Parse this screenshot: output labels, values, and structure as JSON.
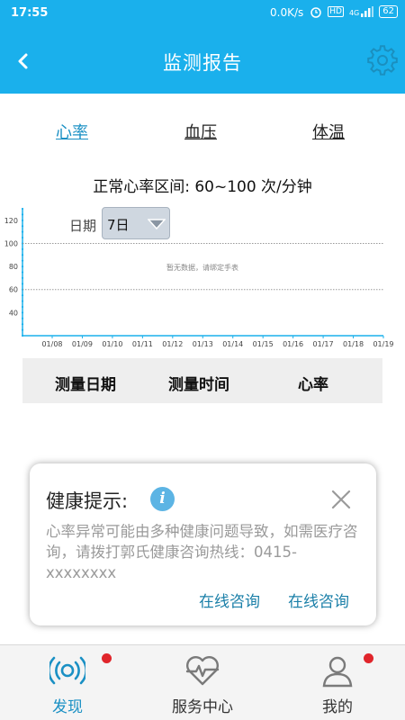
{
  "status_bar": {
    "time": "17:55",
    "speed": "0.0K/s",
    "hd": "HD",
    "network": "4G",
    "battery": "62"
  },
  "header": {
    "title": "监测报告",
    "back_icon": "chevron-left-icon",
    "settings_icon": "gear-icon"
  },
  "tabs": [
    {
      "label": "心率",
      "active": true
    },
    {
      "label": "血压",
      "active": false
    },
    {
      "label": "体温",
      "active": false
    }
  ],
  "range_text": "正常心率区间: 60~100 次/分钟",
  "date_filter": {
    "label": "日期",
    "value": "7日"
  },
  "chart_data": {
    "type": "line",
    "x": [
      "01/08",
      "01/09",
      "01/10",
      "01/11",
      "01/12",
      "01/13",
      "01/14",
      "01/15",
      "01/16",
      "01/17",
      "01/18",
      "01/19"
    ],
    "y_ticks": [
      40,
      60,
      80,
      100,
      120
    ],
    "ylim": [
      20,
      130
    ],
    "reference_lines": [
      60,
      100
    ],
    "series": [],
    "no_data_text": "暂无数据，请绑定手表",
    "accent_color": "#1ab0ec"
  },
  "table": {
    "columns": [
      "测量日期",
      "测量时间",
      "心率"
    ],
    "rows": []
  },
  "health_tip": {
    "title": "健康提示:",
    "text": "心率异常可能由多种健康问题导致，如需医疗咨询，请拨打郭氏健康咨询热线：0415-xxxxxxxx",
    "links": [
      "在线咨询",
      "在线咨询"
    ]
  },
  "bottom_nav": [
    {
      "label": "发现",
      "icon": "pulse-signal-icon",
      "active": true,
      "badge": true
    },
    {
      "label": "服务中心",
      "icon": "heart-rate-icon",
      "active": false,
      "badge": false
    },
    {
      "label": "我的",
      "icon": "user-icon",
      "active": false,
      "badge": true
    }
  ],
  "colors": {
    "brand": "#1ab0ec",
    "active_tab": "#1a90c4",
    "badge": "#e0252b"
  }
}
